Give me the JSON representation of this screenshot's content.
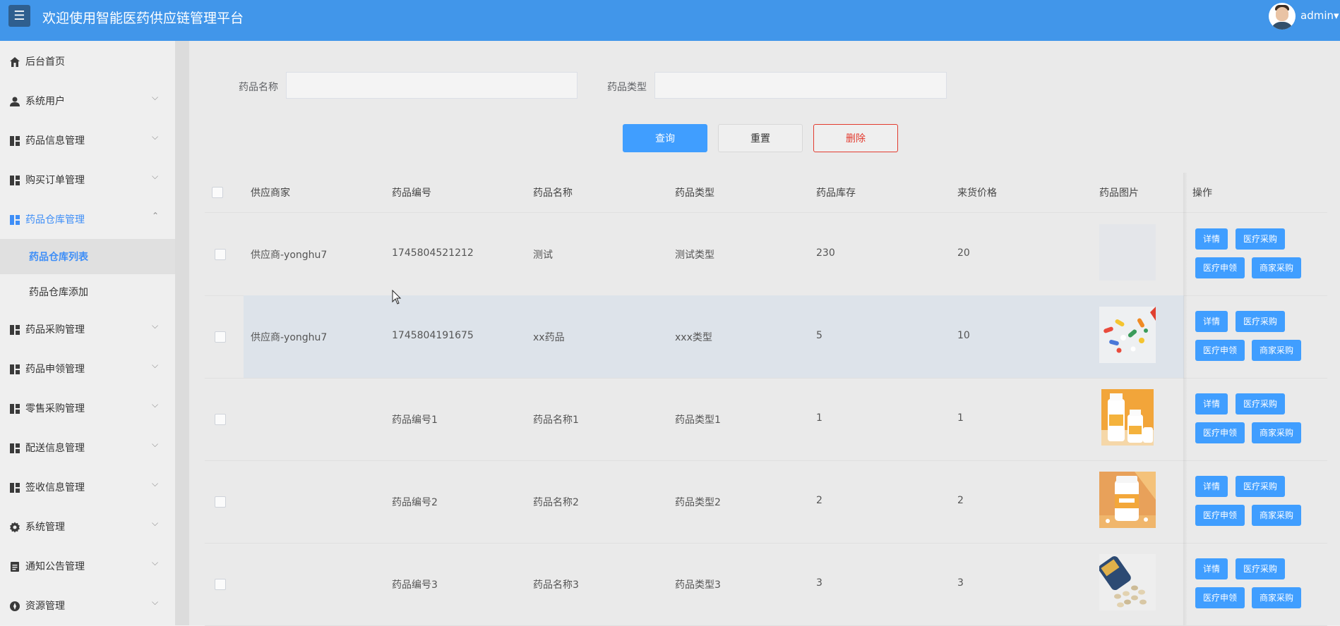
{
  "header": {
    "menu_icon": "hamburger-icon",
    "title": "欢迎使用智能医药供应链管理平台",
    "user": "admin",
    "user_caret": "▾"
  },
  "sidebar": {
    "items": [
      {
        "label": "后台首页",
        "icon": "home-icon",
        "arrow": ""
      },
      {
        "label": "系统用户",
        "icon": "user-icon",
        "arrow": "⌵"
      },
      {
        "label": "药品信息管理",
        "icon": "grid-icon",
        "arrow": "⌵"
      },
      {
        "label": "购买订单管理",
        "icon": "grid-icon",
        "arrow": "⌵"
      },
      {
        "label": "药品仓库管理",
        "icon": "grid-icon",
        "arrow": "⌃"
      },
      {
        "label": "药品采购管理",
        "icon": "grid-icon",
        "arrow": "⌵"
      },
      {
        "label": "药品申领管理",
        "icon": "grid-icon",
        "arrow": "⌵"
      },
      {
        "label": "零售采购管理",
        "icon": "grid-icon",
        "arrow": "⌵"
      },
      {
        "label": "配送信息管理",
        "icon": "grid-icon",
        "arrow": "⌵"
      },
      {
        "label": "签收信息管理",
        "icon": "grid-icon",
        "arrow": "⌵"
      },
      {
        "label": "系统管理",
        "icon": "gear-icon",
        "arrow": "⌵"
      },
      {
        "label": "通知公告管理",
        "icon": "document-icon",
        "arrow": "⌵"
      },
      {
        "label": "资源管理",
        "icon": "resource-icon",
        "arrow": "⌵"
      }
    ],
    "sub_items": [
      {
        "label": "药品仓库列表"
      },
      {
        "label": "药品仓库添加"
      }
    ]
  },
  "search": {
    "name_label": "药品名称",
    "name_value": "",
    "type_label": "药品类型",
    "type_value": "",
    "query_button": "查询",
    "reset_button": "重置",
    "delete_button": "删除"
  },
  "table": {
    "headers": [
      "供应商家",
      "药品编号",
      "药品名称",
      "药品类型",
      "药品库存",
      "来货价格",
      "药品图片",
      "操作"
    ],
    "rows": [
      {
        "supplier": "供应商-yonghu7",
        "code": "1745804521212",
        "name": "测试",
        "type": "测试类型",
        "stock": "230",
        "price": "20",
        "image": "blank"
      },
      {
        "supplier": "供应商-yonghu7",
        "code": "1745804191675",
        "name": "xx药品",
        "type": "xxx类型",
        "stock": "5",
        "price": "10",
        "image": "pills"
      },
      {
        "supplier": "",
        "code": "药品编号1",
        "name": "药品名称1",
        "type": "药品类型1",
        "stock": "1",
        "price": "1",
        "image": "bottles-orange"
      },
      {
        "supplier": "",
        "code": "药品编号2",
        "name": "药品名称2",
        "type": "药品类型2",
        "stock": "2",
        "price": "2",
        "image": "jar-orange"
      },
      {
        "supplier": "",
        "code": "药品编号3",
        "name": "药品名称3",
        "type": "药品类型3",
        "stock": "3",
        "price": "3",
        "image": "tablets-bottle"
      }
    ],
    "actions": {
      "detail": "详情",
      "medical_purchase": "医疗采购",
      "medical_claim": "医疗申领",
      "merchant_purchase": "商家采购"
    }
  },
  "colors": {
    "header": "#4196ea",
    "primary": "#409eff",
    "danger": "#e23b2f",
    "active_nav": "#3e8ef7"
  }
}
